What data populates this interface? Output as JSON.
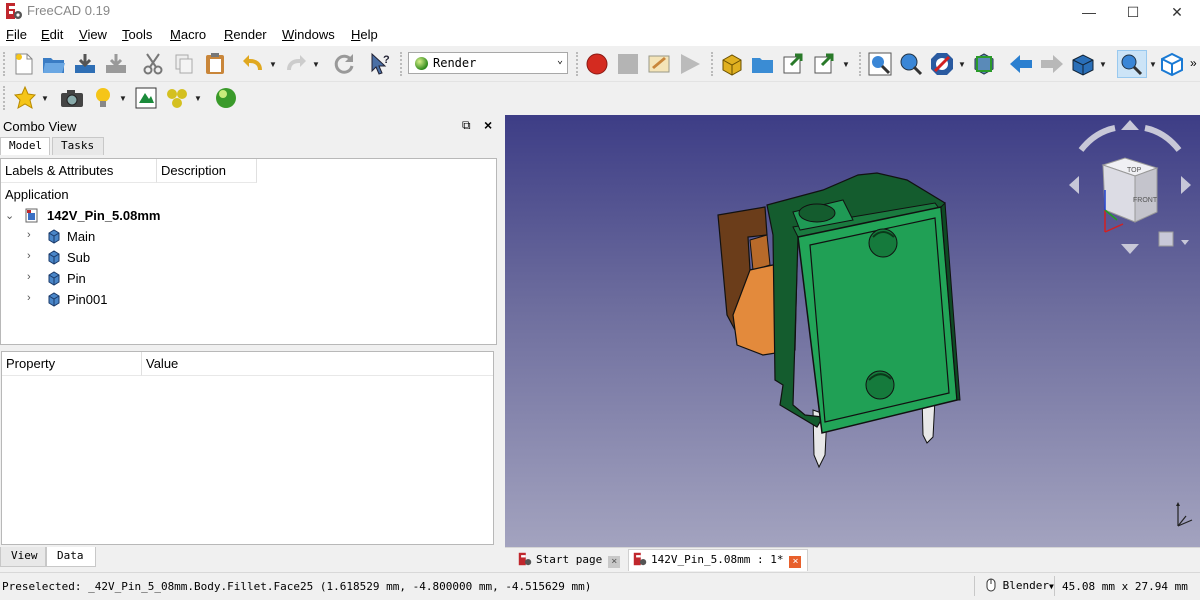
{
  "window": {
    "title": "FreeCAD 0.19"
  },
  "menu": [
    "File",
    "Edit",
    "View",
    "Tools",
    "Macro",
    "Render",
    "Windows",
    "Help"
  ],
  "toolbar": {
    "workbench": "Render",
    "overflow": "»"
  },
  "combo": {
    "title": "Combo View",
    "tabs": [
      "Model",
      "Tasks"
    ],
    "tree_headers": [
      "Labels & Attributes",
      "Description"
    ],
    "section": "Application",
    "document": "142V_Pin_5.08mm",
    "children": [
      "Main",
      "Sub",
      "Pin",
      "Pin001"
    ],
    "prop_headers": [
      "Property",
      "Value"
    ],
    "bottom_tabs": [
      "View",
      "Data"
    ]
  },
  "doc_tabs": [
    "Start page",
    "142V_Pin_5.08mm : 1*"
  ],
  "status": {
    "message": "Preselected: _42V_Pin_5_08mm.Body.Fillet.Face25 (1.618529 mm, -4.800000 mm, -4.515629 mm)",
    "nav_style": "Blender",
    "dims": "45.08 mm x 27.94 mm"
  },
  "navcube": {
    "face_top": "TOP",
    "face_front": "FRONT"
  },
  "colors": {
    "part_green": "#1f9a55",
    "part_orange": "#e38a3c",
    "viewport_top": "#3d3d86",
    "viewport_bottom": "#a3a3bf"
  }
}
